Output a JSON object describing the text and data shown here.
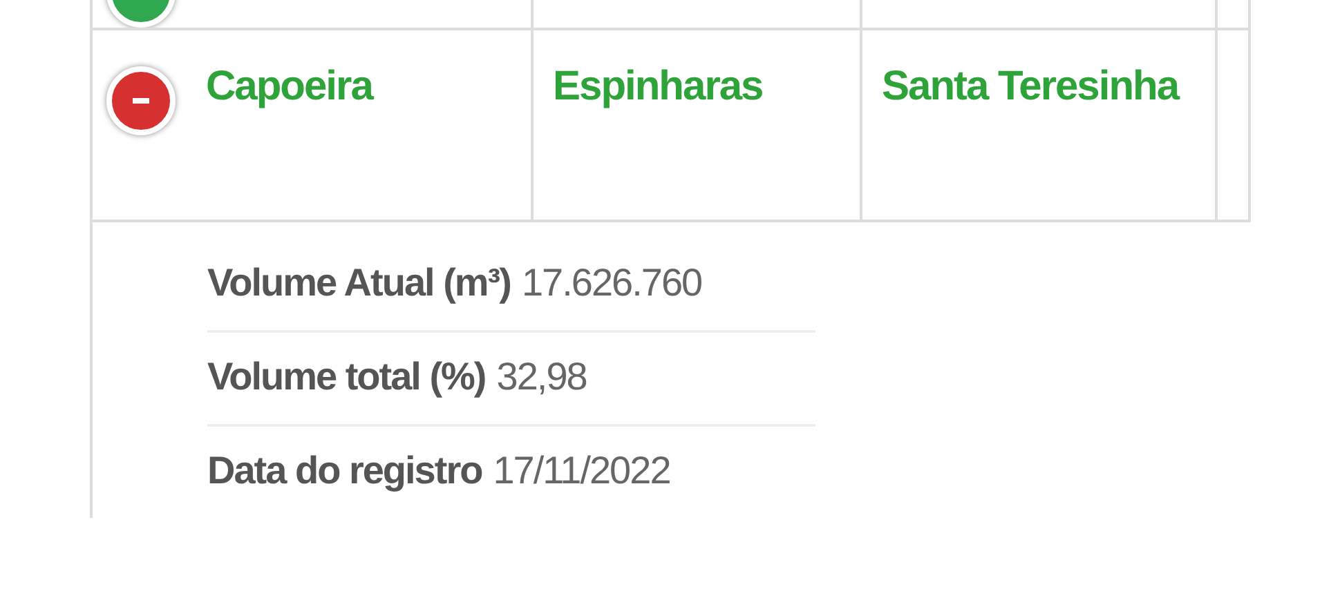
{
  "table": {
    "rows": [
      {
        "expanded": false
      },
      {
        "expanded": true,
        "cells": [
          "Capoeira",
          "Espinharas",
          "Santa Teresinha"
        ],
        "details": [
          {
            "label": "Volume Atual (m³)",
            "value": "17.626.760"
          },
          {
            "label": "Volume total (%)",
            "value": "32,98"
          },
          {
            "label": "Data do registro",
            "value": "17/11/2022"
          }
        ]
      }
    ]
  }
}
